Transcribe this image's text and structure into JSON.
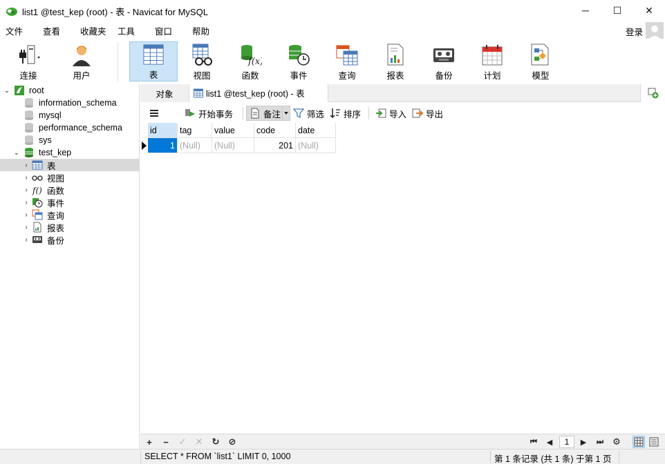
{
  "window": {
    "title": "list1 @test_kep (root) - 表 - Navicat for MySQL",
    "minimize": "─",
    "maximize": "☐",
    "close": "✕"
  },
  "menu": [
    "文件",
    "查看",
    "收藏夹",
    "工具",
    "窗口",
    "帮助"
  ],
  "login_label": "登录",
  "toolbar": [
    {
      "label": "连接",
      "icon": "connect-icon"
    },
    {
      "label": "用户",
      "icon": "user-icon"
    },
    {
      "label": "表",
      "icon": "table-icon",
      "active": true
    },
    {
      "label": "视图",
      "icon": "view-icon"
    },
    {
      "label": "函数",
      "icon": "function-icon"
    },
    {
      "label": "事件",
      "icon": "event-icon"
    },
    {
      "label": "查询",
      "icon": "query-icon"
    },
    {
      "label": "报表",
      "icon": "report-icon"
    },
    {
      "label": "备份",
      "icon": "backup-icon"
    },
    {
      "label": "计划",
      "icon": "schedule-icon"
    },
    {
      "label": "模型",
      "icon": "model-icon"
    }
  ],
  "tree": {
    "connection": "root",
    "databases": [
      "information_schema",
      "mysql",
      "performance_schema",
      "sys",
      "test_kep"
    ],
    "children": [
      "表",
      "视图",
      "函数",
      "事件",
      "查询",
      "报表",
      "备份"
    ]
  },
  "tabs": {
    "objects": "对象",
    "current": "list1 @test_kep (root) - 表"
  },
  "subtoolbar": {
    "begin_transaction": "开始事务",
    "memo": "备注",
    "filter": "筛选",
    "sort": "排序",
    "import": "导入",
    "export": "导出"
  },
  "grid": {
    "columns": [
      "id",
      "tag",
      "value",
      "code",
      "date"
    ],
    "rows": [
      [
        "1",
        "(Null)",
        "(Null)",
        "201",
        "(Null)"
      ]
    ]
  },
  "bottombar": {
    "add": "+",
    "delete": "−",
    "apply": "✓",
    "cancel": "✕",
    "refresh": "↻",
    "stop": "⊘",
    "first": "⏮",
    "prev": "◀",
    "page": "1",
    "next": "▶",
    "last": "⏭",
    "settings": "⚙"
  },
  "status": {
    "sql": "SELECT * FROM `list1` LIMIT 0, 1000",
    "records": "第 1 条记录 (共 1 条) 于第 1 页"
  }
}
